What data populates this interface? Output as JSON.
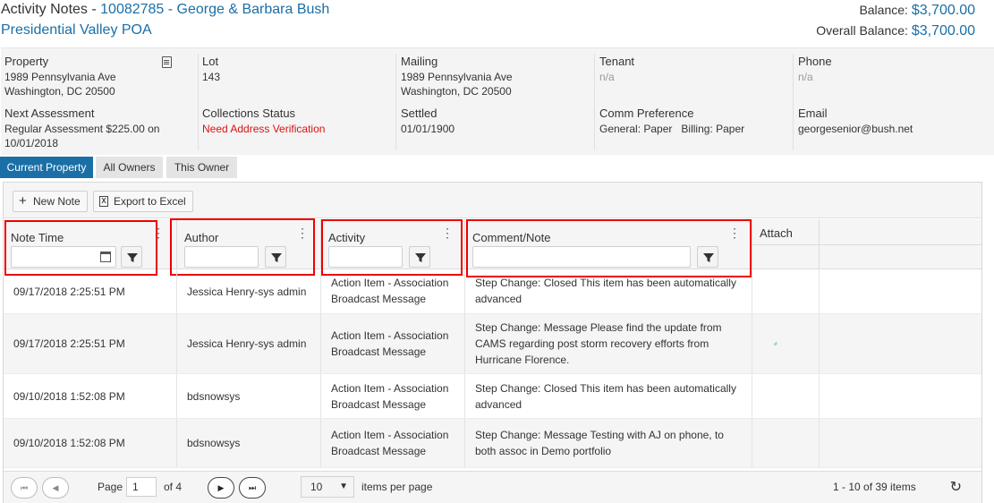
{
  "header": {
    "title_prefix": "Activity Notes - ",
    "account": "10082785 - George & Barbara Bush",
    "association": "Presidential Valley POA",
    "balance_label": "Balance: ",
    "balance": "$3,700.00",
    "overall_label": "Overall Balance: ",
    "overall_balance": "$3,700.00"
  },
  "info": {
    "property_label": "Property",
    "property_line1": "1989 Pennsylvania Ave",
    "property_line2": "Washington, DC 20500",
    "lot_label": "Lot",
    "lot_value": "143",
    "mailing_label": "Mailing",
    "mailing_line1": "1989 Pennsylvania Ave",
    "mailing_line2": "Washington, DC 20500",
    "tenant_label": "Tenant",
    "tenant_value": "n/a",
    "phone_label": "Phone",
    "phone_value": "n/a",
    "next_assessment_label": "Next Assessment",
    "next_assessment_line1": "Regular Assessment $225.00 on",
    "next_assessment_line2": "10/01/2018",
    "collections_label": "Collections Status",
    "collections_value": "Need Address Verification",
    "settled_label": "Settled",
    "settled_value": "01/01/1900",
    "comm_label": "Comm Preference",
    "comm_general": "General: Paper",
    "comm_billing": "Billing: Paper",
    "email_label": "Email",
    "email_value": "georgesenior@bush.net"
  },
  "tabs": [
    {
      "label": "Current Property",
      "active": true
    },
    {
      "label": "All Owners",
      "active": false
    },
    {
      "label": "This Owner",
      "active": false
    }
  ],
  "toolbar": {
    "new_note": "New Note",
    "export": "Export to Excel"
  },
  "columns": {
    "note_time": "Note Time",
    "author": "Author",
    "activity": "Activity",
    "comment": "Comment/Note",
    "attach": "Attach"
  },
  "rows": [
    {
      "time": "09/17/2018 2:25:51 PM",
      "author": "Jessica Henry-sys admin",
      "activity_l1": "Action Item - Association",
      "activity_l2": "Broadcast Message",
      "comment_l1": "Step Change: Closed This item has been automatically",
      "comment_l2": "advanced",
      "comment_l3": "",
      "attach": false
    },
    {
      "time": "09/17/2018 2:25:51 PM",
      "author": "Jessica Henry-sys admin",
      "activity_l1": "Action Item - Association",
      "activity_l2": "Broadcast Message",
      "comment_l1": "Step Change: Message Please find the update from",
      "comment_l2": "CAMS regarding post storm recovery efforts from",
      "comment_l3": "Hurricane Florence.",
      "attach": true
    },
    {
      "time": "09/10/2018 1:52:08 PM",
      "author": "bdsnowsys",
      "activity_l1": "Action Item - Association",
      "activity_l2": "Broadcast Message",
      "comment_l1": "Step Change: Closed This item has been automatically",
      "comment_l2": "advanced",
      "comment_l3": "",
      "attach": false
    },
    {
      "time": "09/10/2018 1:52:08 PM",
      "author": "bdsnowsys",
      "activity_l1": "Action Item - Association",
      "activity_l2": "Broadcast Message",
      "comment_l1": "Step Change: Message Testing with AJ on phone, to",
      "comment_l2": "both assoc in Demo portfolio",
      "comment_l3": "",
      "attach": false
    }
  ],
  "pager": {
    "page_label": "Page",
    "page_value": "1",
    "of_label": "of 4",
    "per_page": "10",
    "per_page_label": "items per page",
    "summary": "1 - 10 of 39 items"
  },
  "colors": {
    "accent": "#1a6fa6",
    "alert": "#dd1111",
    "highlight_box": "#ee0000",
    "attach_icon": "#2bb24c"
  }
}
